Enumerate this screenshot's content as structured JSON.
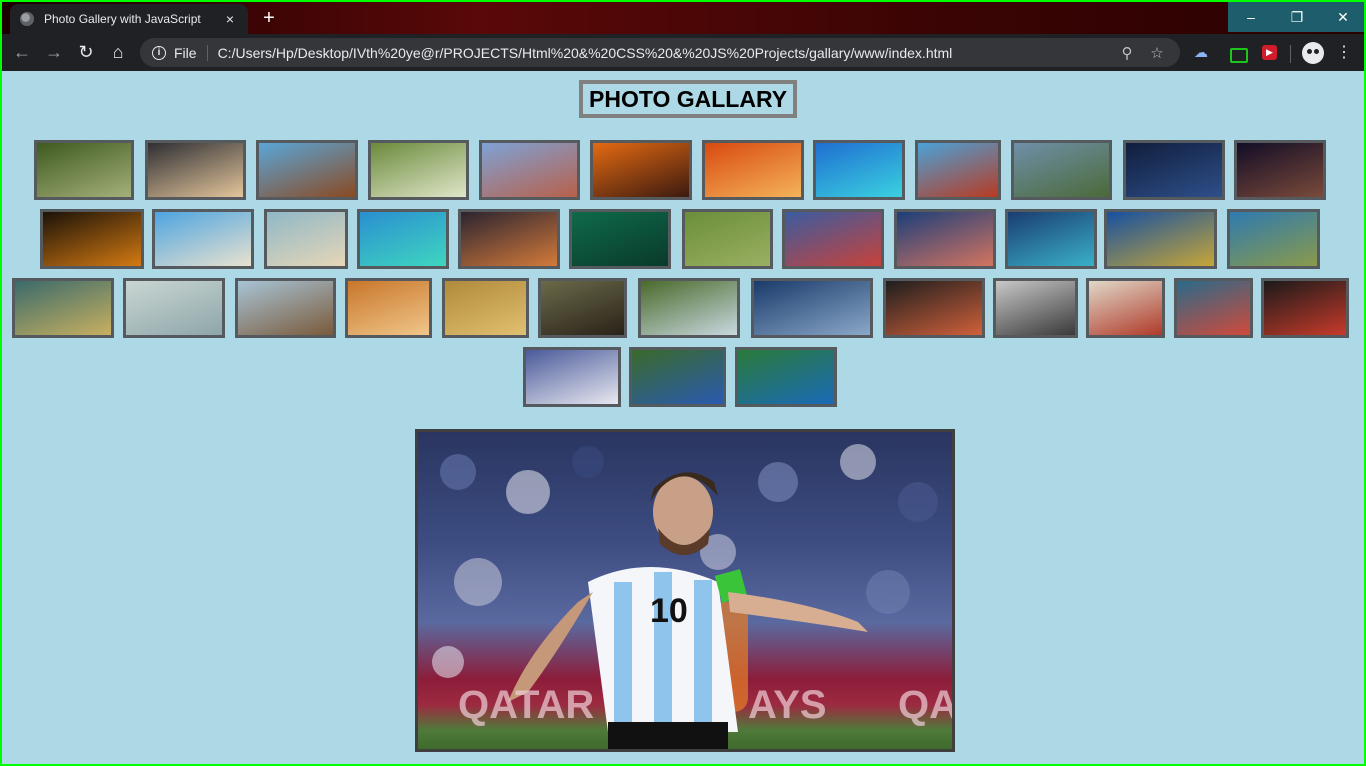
{
  "browser": {
    "tab_title": "Photo Gallery with JavaScript",
    "tab_close": "×",
    "new_tab": "+",
    "controls": {
      "minimize": "–",
      "restore": "❐",
      "close": "✕"
    },
    "nav": {
      "back": "←",
      "forward": "→",
      "reload": "↻",
      "home": "⌂"
    },
    "omnibox": {
      "info": "i",
      "scheme": "File",
      "url": "C:/Users/Hp/Desktop/IVth%20ye@r/PROJECTS/Html%20&%20CSS%20&%20JS%20Projects/gallary/www/index.html",
      "zoom_icon": "⚲",
      "star_icon": "☆"
    },
    "extensions": {
      "cloud": "☁",
      "menu": "⋮"
    }
  },
  "page": {
    "title": "PHOTO GALLARY"
  },
  "thumbnails": [
    {
      "c1": "#3e5a1e",
      "c2": "#a4b07a"
    },
    {
      "c1": "#2e2f33",
      "c2": "#e4c59b"
    },
    {
      "c1": "#5aa6d8",
      "c2": "#8a4a22"
    },
    {
      "c1": "#6b8a3c",
      "c2": "#dfe6c8"
    },
    {
      "c1": "#7ea2d6",
      "c2": "#b8604a"
    },
    {
      "c1": "#e36a12",
      "c2": "#3b1a10"
    },
    {
      "c1": "#d84a10",
      "c2": "#f4b35a"
    },
    {
      "c1": "#1f6fd1",
      "c2": "#3ad1e0"
    },
    {
      "c1": "#4aa2d8",
      "c2": "#b83a22"
    },
    {
      "c1": "#6f8fa8",
      "c2": "#4b6a3a"
    },
    {
      "c1": "#101e3c",
      "c2": "#2e4f8a"
    },
    {
      "c1": "#120d26",
      "c2": "#7a4a3a"
    },
    {
      "c1": "#1b1208",
      "c2": "#d47a12"
    },
    {
      "c1": "#4da4e0",
      "c2": "#e9e2cf"
    },
    {
      "c1": "#8fb8c6",
      "c2": "#e6d6b8"
    },
    {
      "c1": "#2a8fd0",
      "c2": "#3fd6c0"
    },
    {
      "c1": "#2b2430",
      "c2": "#d47a3a"
    },
    {
      "c1": "#0e6a4a",
      "c2": "#0a3a2a"
    },
    {
      "c1": "#6b8e3a",
      "c2": "#9ab062"
    },
    {
      "c1": "#3a5ca0",
      "c2": "#c8423a"
    },
    {
      "c1": "#1c3e7a",
      "c2": "#d47460"
    },
    {
      "c1": "#1a3d70",
      "c2": "#3ab0c8"
    },
    {
      "c1": "#1650a0",
      "c2": "#c6a638"
    },
    {
      "c1": "#2e7ab0",
      "c2": "#8a9a4a"
    },
    {
      "c1": "#3a6a6a",
      "c2": "#c8b060"
    },
    {
      "c1": "#c9d6d2",
      "c2": "#8ea6aa"
    },
    {
      "c1": "#a8c4d6",
      "c2": "#7a5a3a"
    },
    {
      "c1": "#c8762a",
      "c2": "#f0c68a"
    },
    {
      "c1": "#b08a3a",
      "c2": "#e0c070"
    },
    {
      "c1": "#6a6a4a",
      "c2": "#2a2218"
    },
    {
      "c1": "#4a6a2a",
      "c2": "#c8d8e0"
    },
    {
      "c1": "#1a3a6a",
      "c2": "#8aa8c8"
    },
    {
      "c1": "#1e1e1e",
      "c2": "#d0603a"
    },
    {
      "c1": "#c8c8c8",
      "c2": "#3a3a3a"
    },
    {
      "c1": "#e0d8c8",
      "c2": "#b03a2a"
    },
    {
      "c1": "#2a6a8a",
      "c2": "#d04a3a"
    },
    {
      "c1": "#1a1a1a",
      "c2": "#c83a2a"
    },
    {
      "c1": "#4a5a9a",
      "c2": "#e8e8f0"
    },
    {
      "c1": "#3a6a2a",
      "c2": "#2a5ab0"
    },
    {
      "c1": "#2a7a3a",
      "c2": "#1a6ab8"
    }
  ],
  "main_image": {
    "label": "Lionel Messi celebrating in Argentina jersey number 10"
  }
}
